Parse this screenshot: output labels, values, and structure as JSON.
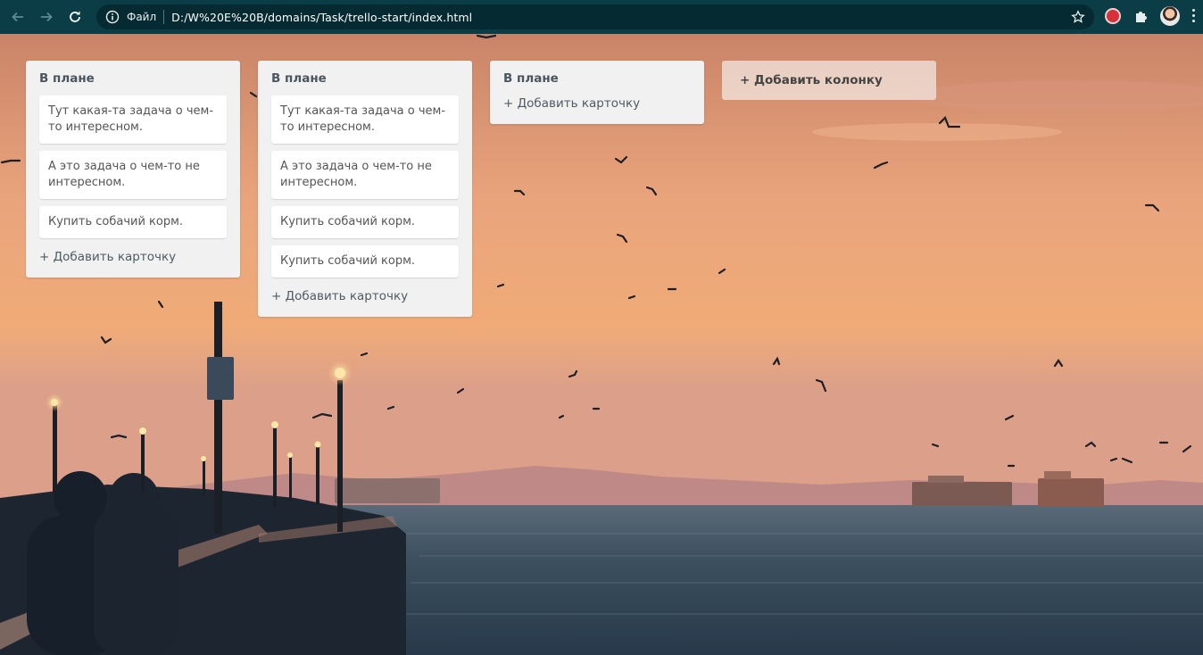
{
  "browser": {
    "file_label": "Файл",
    "url": "D:/W%20E%20B/domains/Task/trello-start/index.html"
  },
  "board": {
    "columns": [
      {
        "title": "В плане",
        "cards": [
          "Тут какая-та задача о чем-то интересном.",
          "А это задача о чем-то не интересном.",
          "Купить собачий корм."
        ],
        "add_card_label": "+ Добавить карточку"
      },
      {
        "title": "В плане",
        "cards": [
          "Тут какая-та задача о чем-то интересном.",
          "А это задача о чем-то не интересном.",
          "Купить собачий корм.",
          "Купить собачий корм."
        ],
        "add_card_label": "+ Добавить карточку"
      },
      {
        "title": "В плане",
        "cards": [],
        "add_card_label": "+ Добавить карточку"
      }
    ],
    "add_column_label": "+ Добавить колонку"
  },
  "colors": {
    "chrome_bg": "#0b3d46",
    "omnibox_bg": "#062a31",
    "column_bg": "#f1f1f1",
    "sky_top": "#c98468",
    "sky_mid": "#f0ab78",
    "sea": "#2c4150"
  }
}
